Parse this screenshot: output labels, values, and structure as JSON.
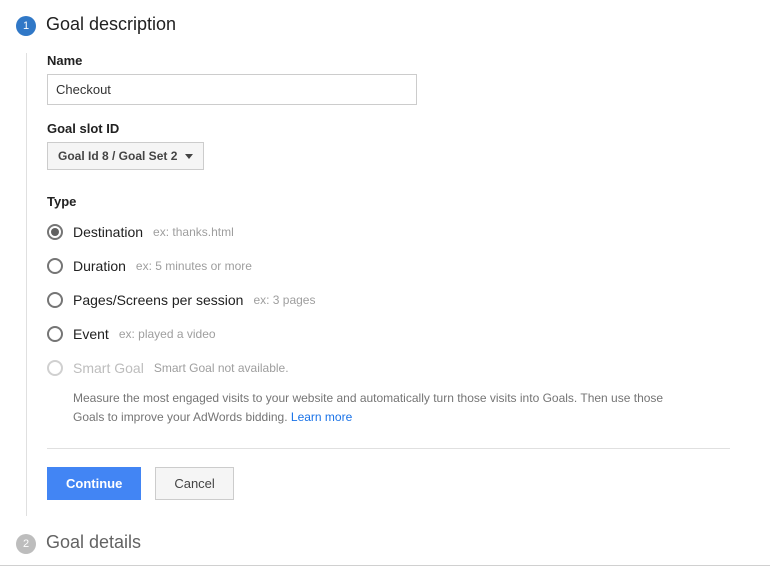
{
  "steps": {
    "step1": {
      "number": "1",
      "title": "Goal description"
    },
    "step2": {
      "number": "2",
      "title": "Goal details"
    }
  },
  "nameField": {
    "label": "Name",
    "value": "Checkout"
  },
  "slotField": {
    "label": "Goal slot ID",
    "selected": "Goal Id 8 / Goal Set 2"
  },
  "typeField": {
    "label": "Type",
    "options": {
      "destination": {
        "label": "Destination",
        "hint": "ex: thanks.html"
      },
      "duration": {
        "label": "Duration",
        "hint": "ex: 5 minutes or more"
      },
      "pages": {
        "label": "Pages/Screens per session",
        "hint": "ex: 3 pages"
      },
      "event": {
        "label": "Event",
        "hint": "ex: played a video"
      },
      "smart": {
        "label": "Smart Goal",
        "hint": "Smart Goal not available."
      }
    },
    "smartDescription": "Measure the most engaged visits to your website and automatically turn those visits into Goals. Then use those Goals to improve your AdWords bidding. ",
    "learnMore": "Learn more"
  },
  "buttons": {
    "continue": "Continue",
    "cancel": "Cancel"
  }
}
